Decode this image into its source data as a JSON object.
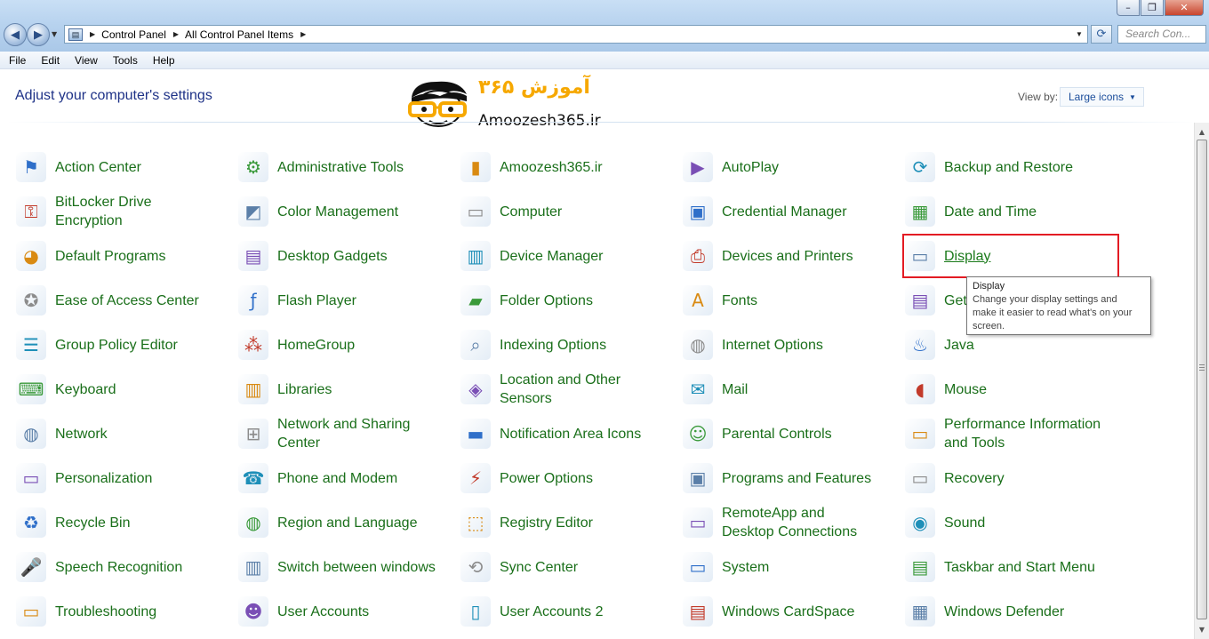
{
  "window": {
    "controls": [
      "–",
      "❐",
      "✕"
    ]
  },
  "address": {
    "crumbs": [
      "Control Panel",
      "All Control Panel Items"
    ],
    "search_placeholder": "Search Con..."
  },
  "menu": [
    "File",
    "Edit",
    "View",
    "Tools",
    "Help"
  ],
  "heading": "Adjust your computer's settings",
  "logo": {
    "persian": "آموزش ۳۶۵",
    "english": "Amoozesh365.ir"
  },
  "view_by": {
    "label": "View by:",
    "value": "Large icons"
  },
  "items": [
    [
      "Action Center",
      "Administrative Tools",
      "Amoozesh365.ir",
      "AutoPlay",
      "Backup and Restore"
    ],
    [
      "BitLocker Drive Encryption",
      "Color Management",
      "Computer",
      "Credential Manager",
      "Date and Time"
    ],
    [
      "Default Programs",
      "Desktop Gadgets",
      "Device Manager",
      "Devices and Printers",
      "Display"
    ],
    [
      "Ease of Access Center",
      "Flash Player",
      "Folder Options",
      "Fonts",
      "Getting Started"
    ],
    [
      "Group Policy Editor",
      "HomeGroup",
      "Indexing Options",
      "Internet Options",
      "Java"
    ],
    [
      "Keyboard",
      "Libraries",
      "Location and Other Sensors",
      "Mail",
      "Mouse"
    ],
    [
      "Network",
      "Network and Sharing Center",
      "Notification Area Icons",
      "Parental Controls",
      "Performance Information and Tools"
    ],
    [
      "Personalization",
      "Phone and Modem",
      "Power Options",
      "Programs and Features",
      "Recovery"
    ],
    [
      "Recycle Bin",
      "Region and Language",
      "Registry Editor",
      "RemoteApp and Desktop Connections",
      "Sound"
    ],
    [
      "Speech Recognition",
      "Switch between windows",
      "Sync Center",
      "System",
      "Taskbar and Start Menu"
    ],
    [
      "Troubleshooting",
      "User Accounts",
      "User Accounts 2",
      "Windows CardSpace",
      "Windows Defender"
    ]
  ],
  "item_icons": [
    [
      "flag-icon",
      "tools-icon",
      "user-folder-icon",
      "autoplay-icon",
      "backup-icon"
    ],
    [
      "bitlocker-icon",
      "color-management-icon",
      "computer-icon",
      "credential-vault-icon",
      "calendar-clock-icon"
    ],
    [
      "default-programs-icon",
      "gadgets-icon",
      "device-manager-icon",
      "printer-icon",
      "display-monitor-icon"
    ],
    [
      "ease-of-access-icon",
      "flash-icon",
      "folder-options-icon",
      "fonts-folder-icon",
      "getting-started-icon"
    ],
    [
      "policy-scroll-icon",
      "homegroup-icon",
      "indexing-magnifier-icon",
      "internet-globe-icon",
      "java-cup-icon"
    ],
    [
      "keyboard-icon",
      "libraries-icon",
      "sensor-icon",
      "mail-icon",
      "mouse-icon"
    ],
    [
      "network-globe-icon",
      "network-sharing-icon",
      "notification-icons-icon",
      "parental-controls-icon",
      "performance-monitor-icon"
    ],
    [
      "personalization-icon",
      "phone-modem-icon",
      "power-options-icon",
      "programs-features-icon",
      "recovery-icon"
    ],
    [
      "recycle-bin-icon",
      "region-globe-icon",
      "registry-cubes-icon",
      "remoteapp-icon",
      "sound-speaker-icon"
    ],
    [
      "microphone-icon",
      "switch-windows-icon",
      "sync-center-icon",
      "system-icon",
      "taskbar-icon"
    ],
    [
      "troubleshooting-icon",
      "user-accounts-icon",
      "blank-document-icon",
      "cardspace-icon",
      "windows-defender-icon"
    ]
  ],
  "hovered_item": "Display",
  "tooltip": {
    "title": "Display",
    "line1": "Change your display settings and",
    "line2": "make it easier to read what's on your",
    "line3": "screen."
  },
  "colors": {
    "link_green": "#1a6f1a",
    "heading_blue": "#1e3287",
    "highlight_red": "#e31b23",
    "logo_orange": "#f6a800"
  }
}
